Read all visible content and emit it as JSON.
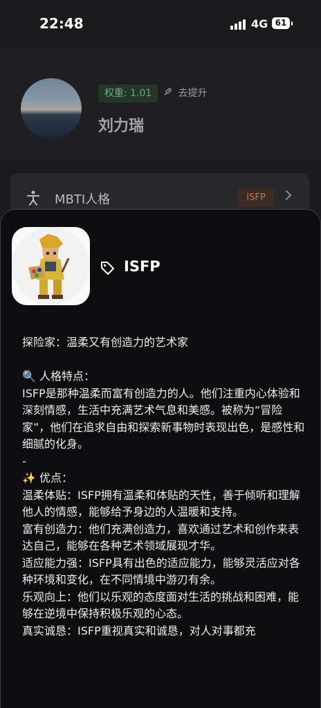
{
  "status_bar": {
    "time": "22:48",
    "network": "4G",
    "battery": "61"
  },
  "profile": {
    "weight": "权重: 1.01",
    "boost_label": "去提升",
    "name": "刘力瑞"
  },
  "mbti_row": {
    "label": "MBTI人格",
    "badge": "ISFP"
  },
  "sheet": {
    "type": "ISFP",
    "paragraphs": [
      "探险家：温柔又有创造力的艺术家",
      "",
      "🔍 人格特点：",
      "ISFP是那种温柔而富有创造力的人。他们注重内心体验和深刻情感，生活中充满艺术气息和美感。被称为“冒险家”，他们在追求自由和探索新事物时表现出色，是感性和细腻的化身。",
      "-",
      "✨ 优点：",
      "温柔体贴：ISFP拥有温柔和体贴的天性，善于倾听和理解他人的情感，能够给予身边的人温暖和支持。",
      "富有创造力：他们充满创造力，喜欢通过艺术和创作来表达自己，能够在各种艺术领域展现才华。",
      "适应能力强：ISFP具有出色的适应能力，能够灵活应对各种环境和变化，在不同情境中游刃有余。",
      "乐观向上：他们以乐观的态度面对生活的挑战和困难，能够在逆境中保持积极乐观的心态。",
      "真实诚恳：ISFP重视真实和诚恳，对人对事都充"
    ]
  },
  "icons": {
    "boost": "rocket-icon",
    "mbti": "person-icon",
    "type": "tag-icon",
    "chevron": "chevron-right-icon"
  },
  "colors": {
    "weight_bg": "#24362a",
    "weight_text": "#6aa97d",
    "badge_bg": "#3a2c24",
    "badge_text": "#b5795a"
  }
}
